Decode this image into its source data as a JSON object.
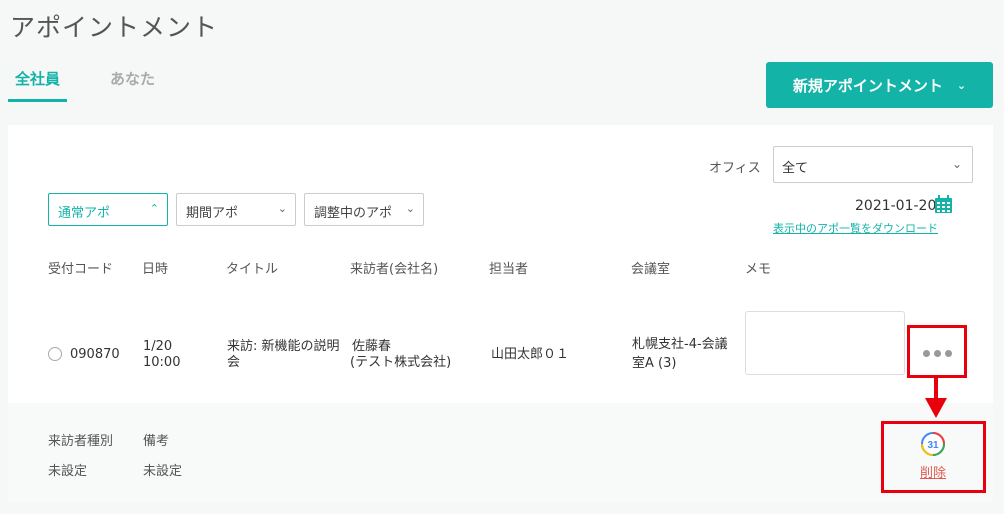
{
  "page": {
    "title": "アポイントメント"
  },
  "tabs": [
    {
      "label": "全社員",
      "active": true
    },
    {
      "label": "あなた",
      "active": false
    }
  ],
  "new_appointment_button": {
    "label": "新規アポイントメント"
  },
  "office_filter": {
    "label": "オフィス",
    "selected": "全て"
  },
  "filters": [
    {
      "label": "通常アポ",
      "active": true
    },
    {
      "label": "期間アポ",
      "active": false
    },
    {
      "label": "調整中のアポ",
      "active": false
    }
  ],
  "date_display": {
    "date": "2021-01-20",
    "download_link": "表示中のアポ一覧をダウンロード"
  },
  "table": {
    "headers": [
      "受付コード",
      "日時",
      "タイトル",
      "来訪者(会社名)",
      "担当者",
      "会議室",
      "メモ"
    ],
    "rows": [
      {
        "code": "090870",
        "date": "1/20",
        "time": "10:00",
        "title_line1": "来訪: 新機能の説明",
        "title_line2": "会",
        "visitor_name": "佐藤春",
        "visitor_company": "(テスト株式会社)",
        "staff": "山田太郎０１",
        "room_line1": "札幌支社-4-会議",
        "room_line2": "室A (3)",
        "memo": ""
      }
    ]
  },
  "details": {
    "visitor_type_label": "来訪者種別",
    "visitor_type_value": "未設定",
    "note_label": "備考",
    "note_value": "未設定",
    "gcal_label": "31",
    "delete_label": "削除"
  },
  "colors": {
    "accent": "#13b3a8",
    "highlight": "#e8000d",
    "delete": "#e05a50"
  }
}
